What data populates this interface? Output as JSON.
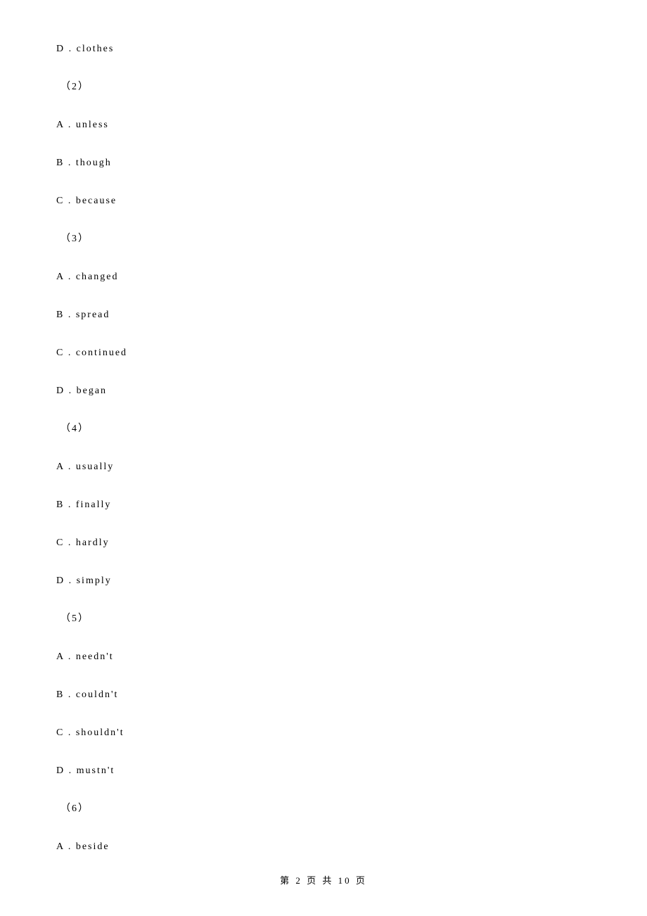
{
  "lines": [
    {
      "text": "D . clothes",
      "indent": "0"
    },
    {
      "text": "（2）",
      "indent": "6"
    },
    {
      "text": "A . unless",
      "indent": "0"
    },
    {
      "text": "B . though",
      "indent": "0"
    },
    {
      "text": "C . because",
      "indent": "0"
    },
    {
      "text": "（3）",
      "indent": "6"
    },
    {
      "text": "A . changed",
      "indent": "0"
    },
    {
      "text": "B . spread",
      "indent": "0"
    },
    {
      "text": "C . continued",
      "indent": "0"
    },
    {
      "text": "D . began",
      "indent": "0"
    },
    {
      "text": "（4）",
      "indent": "6"
    },
    {
      "text": "A . usually",
      "indent": "0"
    },
    {
      "text": "B . finally",
      "indent": "0"
    },
    {
      "text": "C . hardly",
      "indent": "0"
    },
    {
      "text": "D . simply",
      "indent": "0"
    },
    {
      "text": "（5）",
      "indent": "6"
    },
    {
      "text": "A . needn't",
      "indent": "0"
    },
    {
      "text": "B . couldn't",
      "indent": "0"
    },
    {
      "text": "C . shouldn't",
      "indent": "0"
    },
    {
      "text": "D . mustn't",
      "indent": "0"
    },
    {
      "text": "（6）",
      "indent": "6"
    },
    {
      "text": "A . beside",
      "indent": "0"
    }
  ],
  "footer": {
    "text": "第 2 页 共 10 页"
  }
}
